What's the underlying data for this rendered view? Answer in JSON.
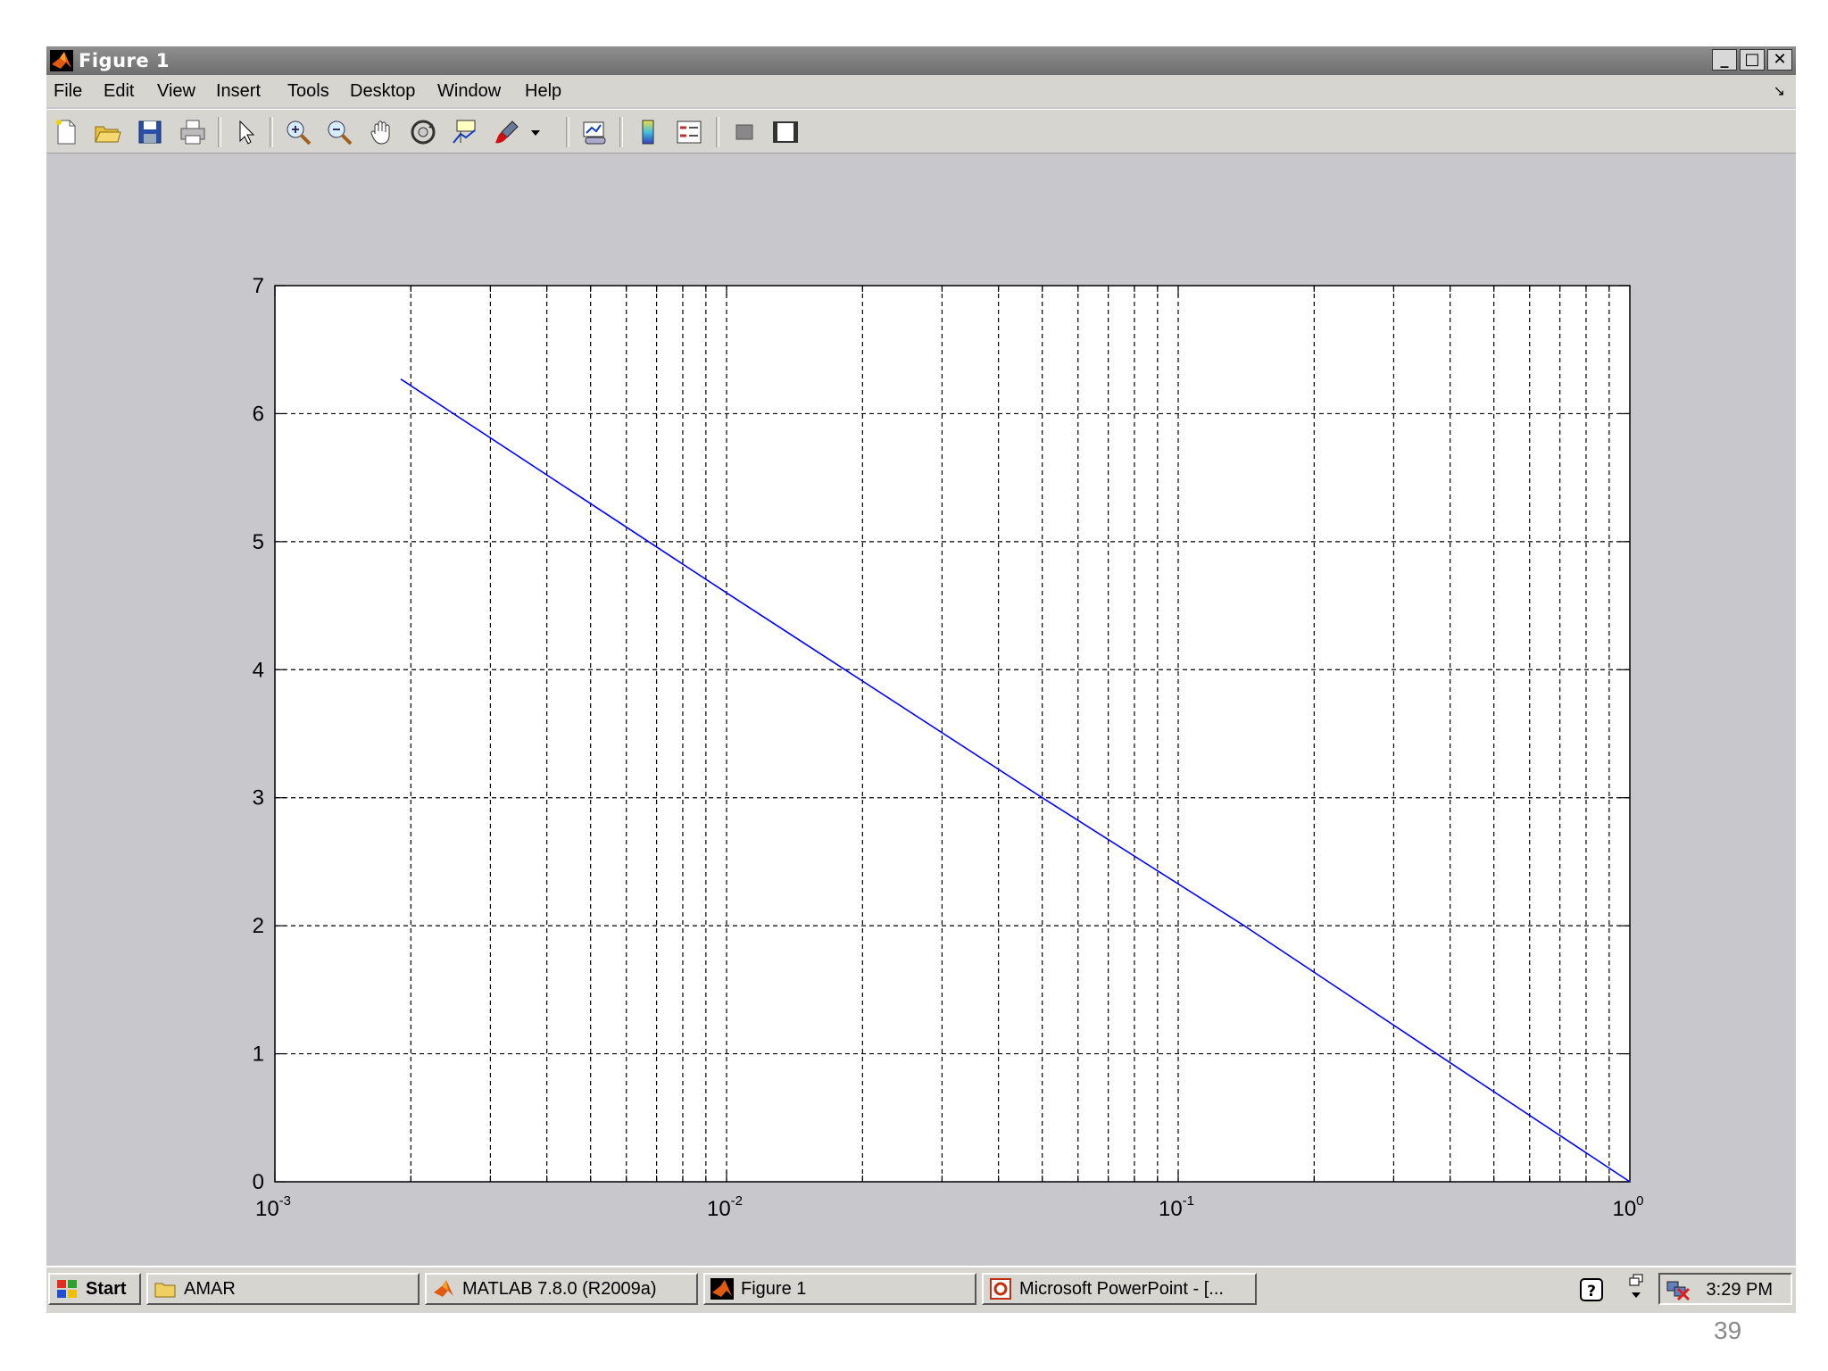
{
  "window": {
    "title": "Figure 1",
    "buttons": [
      "_",
      "□",
      "✕"
    ]
  },
  "menu": [
    "File",
    "Edit",
    "View",
    "Insert",
    "Tools",
    "Desktop",
    "Window",
    "Help"
  ],
  "toolbar": [
    "new-figure-icon",
    "open-file-icon",
    "save-icon",
    "print-icon",
    "pointer-icon",
    "zoom-in-icon",
    "zoom-out-icon",
    "pan-hand-icon",
    "rotate-3d-icon",
    "data-cursor-icon",
    "brush-icon",
    "brush-dropdown-icon",
    "link-plot-icon",
    "colorbar-icon",
    "legend-icon",
    "hide-plot-tools-icon",
    "show-plot-tools-icon"
  ],
  "chart_data": {
    "type": "line",
    "xscale": "log",
    "xlim": [
      0.001,
      1
    ],
    "ylim": [
      0,
      7
    ],
    "xticks": [
      {
        "base": "10",
        "exp": "-3",
        "value": 0.001
      },
      {
        "base": "10",
        "exp": "-2",
        "value": 0.01
      },
      {
        "base": "10",
        "exp": "-1",
        "value": 0.1
      },
      {
        "base": "10",
        "exp": "0",
        "value": 1
      }
    ],
    "yticks": [
      "0",
      "1",
      "2",
      "3",
      "4",
      "5",
      "6",
      "7"
    ],
    "grid": true,
    "line_color": "#0000ff",
    "series": [
      {
        "x": [
          0.0019,
          0.01,
          0.05,
          0.14,
          0.4,
          1
        ],
        "y": [
          6.27,
          4.6,
          3.0,
          2.0,
          0.93,
          0.0
        ]
      }
    ]
  },
  "taskbar": {
    "start_label": "Start",
    "tasks": [
      "AMAR",
      "MATLAB  7.8.0 (R2009a)",
      "Figure 1",
      "Microsoft PowerPoint - [..."
    ],
    "clock": "3:29 PM"
  },
  "slide": {
    "page_number": "39"
  }
}
